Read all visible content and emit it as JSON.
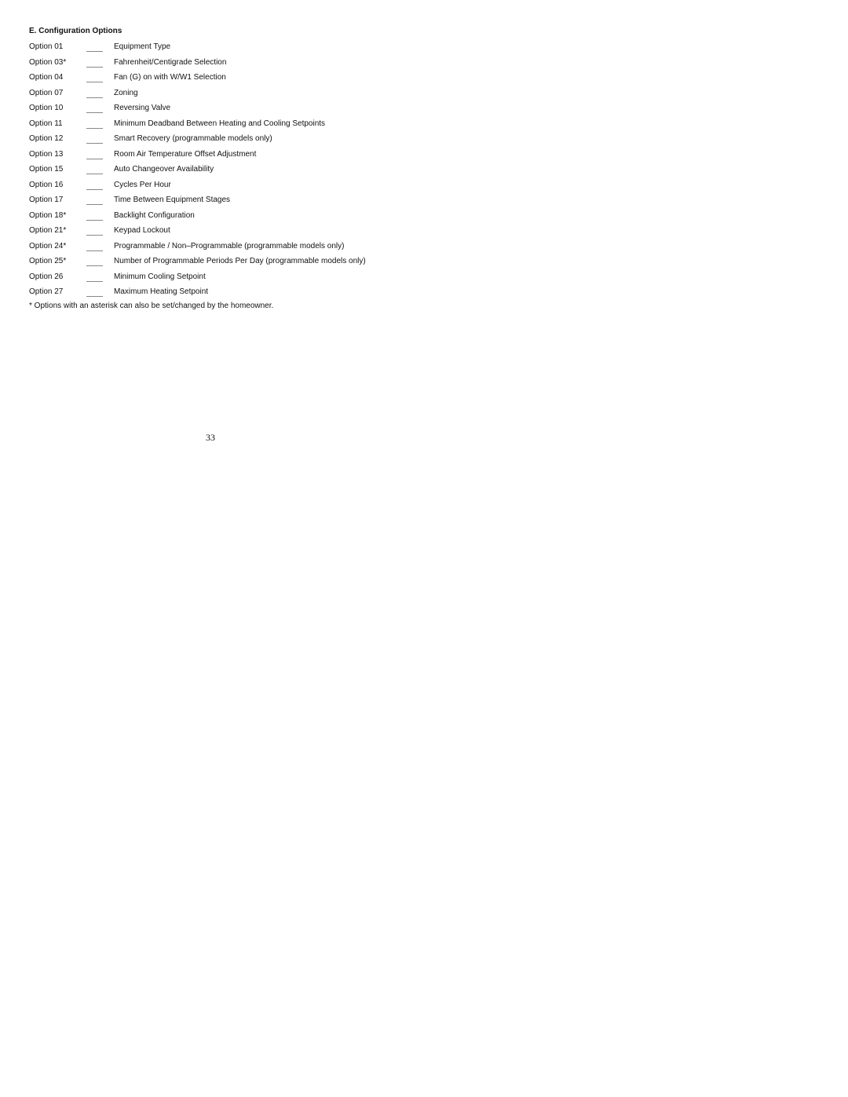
{
  "section": {
    "title": "E. Configuration Options"
  },
  "options": [
    {
      "label": "Option 01",
      "blank": "____",
      "description": "Equipment Type"
    },
    {
      "label": "Option 03*",
      "blank": "____",
      "description": "Fahrenheit/Centigrade Selection"
    },
    {
      "label": "Option 04",
      "blank": "____",
      "description": "Fan (G) on with W/W1 Selection"
    },
    {
      "label": "Option 07",
      "blank": "____",
      "description": "Zoning"
    },
    {
      "label": "Option 10",
      "blank": "____",
      "description": "Reversing Valve"
    },
    {
      "label": "Option 11",
      "blank": "____",
      "description": "Minimum Deadband Between Heating and Cooling Setpoints"
    },
    {
      "label": "Option 12",
      "blank": "____",
      "description": "Smart Recovery (programmable models only)"
    },
    {
      "label": "Option 13",
      "blank": "____",
      "description": "Room Air Temperature Offset Adjustment"
    },
    {
      "label": "Option 15",
      "blank": "____",
      "description": "Auto Changeover Availability"
    },
    {
      "label": "Option 16",
      "blank": "____",
      "description": "Cycles Per Hour"
    },
    {
      "label": "Option 17",
      "blank": "____",
      "description": "Time Between Equipment Stages"
    },
    {
      "label": "Option 18*",
      "blank": "____",
      "description": "Backlight Configuration"
    },
    {
      "label": "Option 21*",
      "blank": "____",
      "description": "Keypad Lockout"
    },
    {
      "label": "Option 24*",
      "blank": "____",
      "description": "Programmable / Non–Programmable (programmable models only)"
    },
    {
      "label": "Option 25*",
      "blank": "____",
      "description": "Number of Programmable Periods Per Day (programmable models only)"
    },
    {
      "label": "Option 26",
      "blank": "____",
      "description": "Minimum Cooling Setpoint"
    },
    {
      "label": "Option 27",
      "blank": "____",
      "description": "Maximum Heating Setpoint"
    }
  ],
  "footnote": "* Options with an asterisk can also be set/changed by the homeowner.",
  "page_number": "33"
}
